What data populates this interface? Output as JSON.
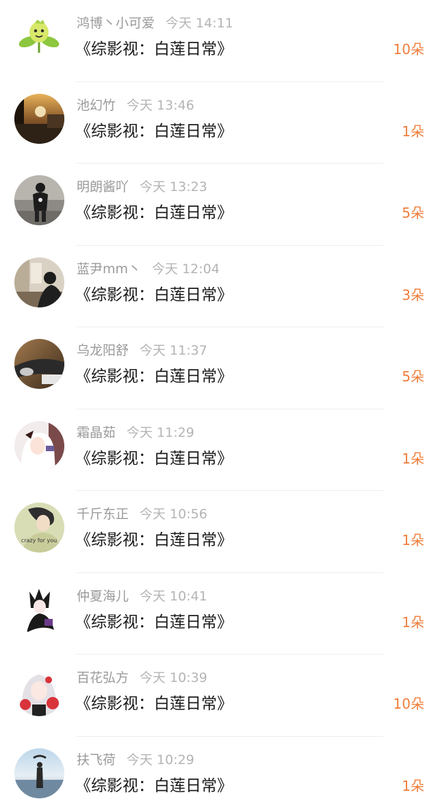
{
  "colors": {
    "name": "#9a9a9a",
    "time": "#b4b4b4",
    "title": "#1a1a1a",
    "flower_count": "#f07d3a",
    "divider": "#ededed"
  },
  "gifts": [
    {
      "avatar_icon": "green-leaf-sprout-icon",
      "name": "鸿博丶小可爱",
      "time": "今天 14:11",
      "book": "《综影视：白莲日常》",
      "count": "10朵"
    },
    {
      "avatar_icon": "sunset-window-photo",
      "name": "池幻竹",
      "time": "今天 13:46",
      "book": "《综影视：白莲日常》",
      "count": "1朵"
    },
    {
      "avatar_icon": "person-in-hoodie-photo",
      "name": "明朗酱吖",
      "time": "今天 13:23",
      "book": "《综影视：白莲日常》",
      "count": "5朵"
    },
    {
      "avatar_icon": "man-in-room-photo",
      "name": "蓝尹mm丶",
      "time": "今天 12:04",
      "book": "《综影视：白莲日常》",
      "count": "3朵"
    },
    {
      "avatar_icon": "car-interior-photo",
      "name": "乌龙阳舒",
      "time": "今天 11:37",
      "book": "《综影视：白莲日常》",
      "count": "5朵"
    },
    {
      "avatar_icon": "white-haired-anime-girl-avatar",
      "name": "霜晶茹",
      "time": "今天 11:29",
      "book": "《综影视：白莲日常》",
      "count": "1朵"
    },
    {
      "avatar_icon": "crazy-for-you-avatar",
      "avatar_caption": "crazy for you",
      "name": "千斤东正",
      "time": "今天 10:56",
      "book": "《综影视：白莲日常》",
      "count": "1朵"
    },
    {
      "avatar_icon": "dark-anime-character-avatar",
      "name": "仲夏海儿",
      "time": "今天 10:41",
      "book": "《综影视：白莲日常》",
      "count": "1朵"
    },
    {
      "avatar_icon": "anime-girl-with-flowers-avatar",
      "name": "百花弘方",
      "time": "今天 10:39",
      "book": "《综影视：白莲日常》",
      "count": "10朵"
    },
    {
      "avatar_icon": "beach-silhouette-photo",
      "name": "扶飞荷",
      "time": "今天 10:29",
      "book": "《综影视：白莲日常》",
      "count": "1朵"
    }
  ]
}
